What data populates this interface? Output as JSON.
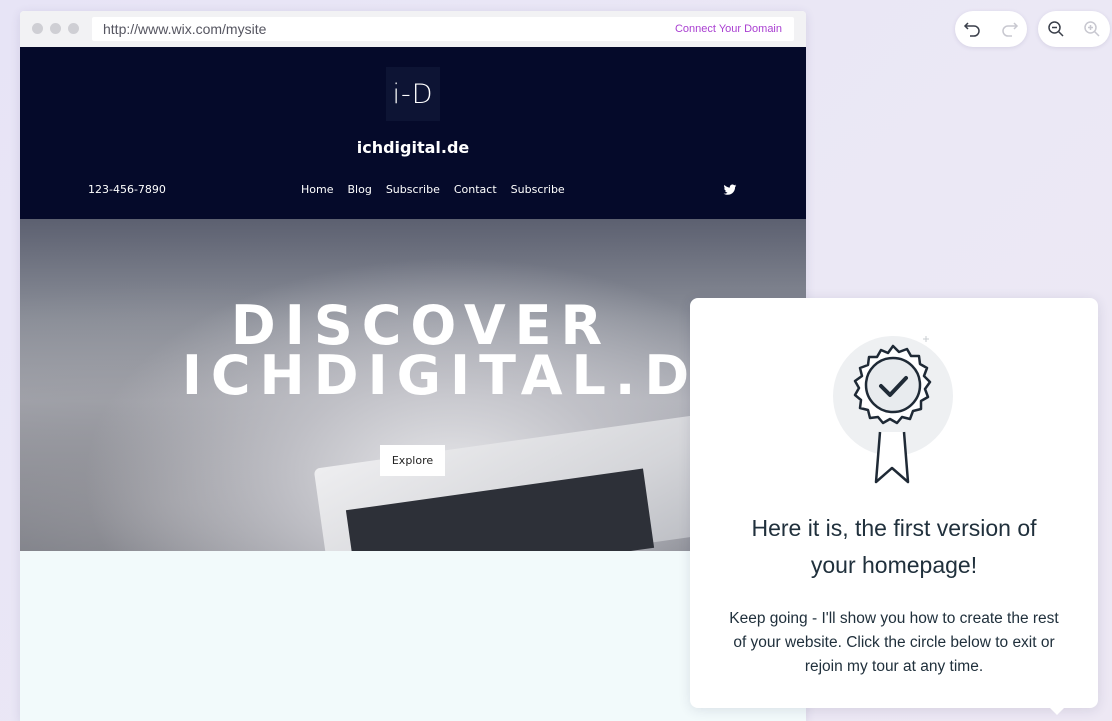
{
  "browser": {
    "url": "http://www.wix.com/mysite",
    "connect_domain": "Connect Your Domain"
  },
  "site": {
    "logo_text": "i-D",
    "name": "ichdigital.de",
    "phone": "123-456-7890",
    "nav": [
      "Home",
      "Blog",
      "Subscribe",
      "Contact",
      "Subscribe"
    ],
    "social_icon": "twitter-icon",
    "hero": {
      "title_line1": "DISCOVER",
      "title_line2": "ICHDIGITAL.DE",
      "button": "Explore"
    }
  },
  "controls": {
    "undo_icon": "undo-icon",
    "redo_icon": "redo-icon",
    "zoom_out_icon": "zoom-out-icon",
    "zoom_in_icon": "zoom-in-icon"
  },
  "tour": {
    "icon": "award-badge-icon",
    "title_line1": "Here it is, the first version of",
    "title_line2": "your homepage!",
    "body_line1": "Keep going - I'll show you how to create the rest",
    "body_line2": "of your website. Click the circle below to exit or",
    "body_line3": "rejoin my tour at any time."
  },
  "colors": {
    "background": "#e9e6f5",
    "header": "#050a2a",
    "accent": "#a93fd1",
    "text_dark": "#20303c",
    "content_bg": "#f2fafb"
  }
}
